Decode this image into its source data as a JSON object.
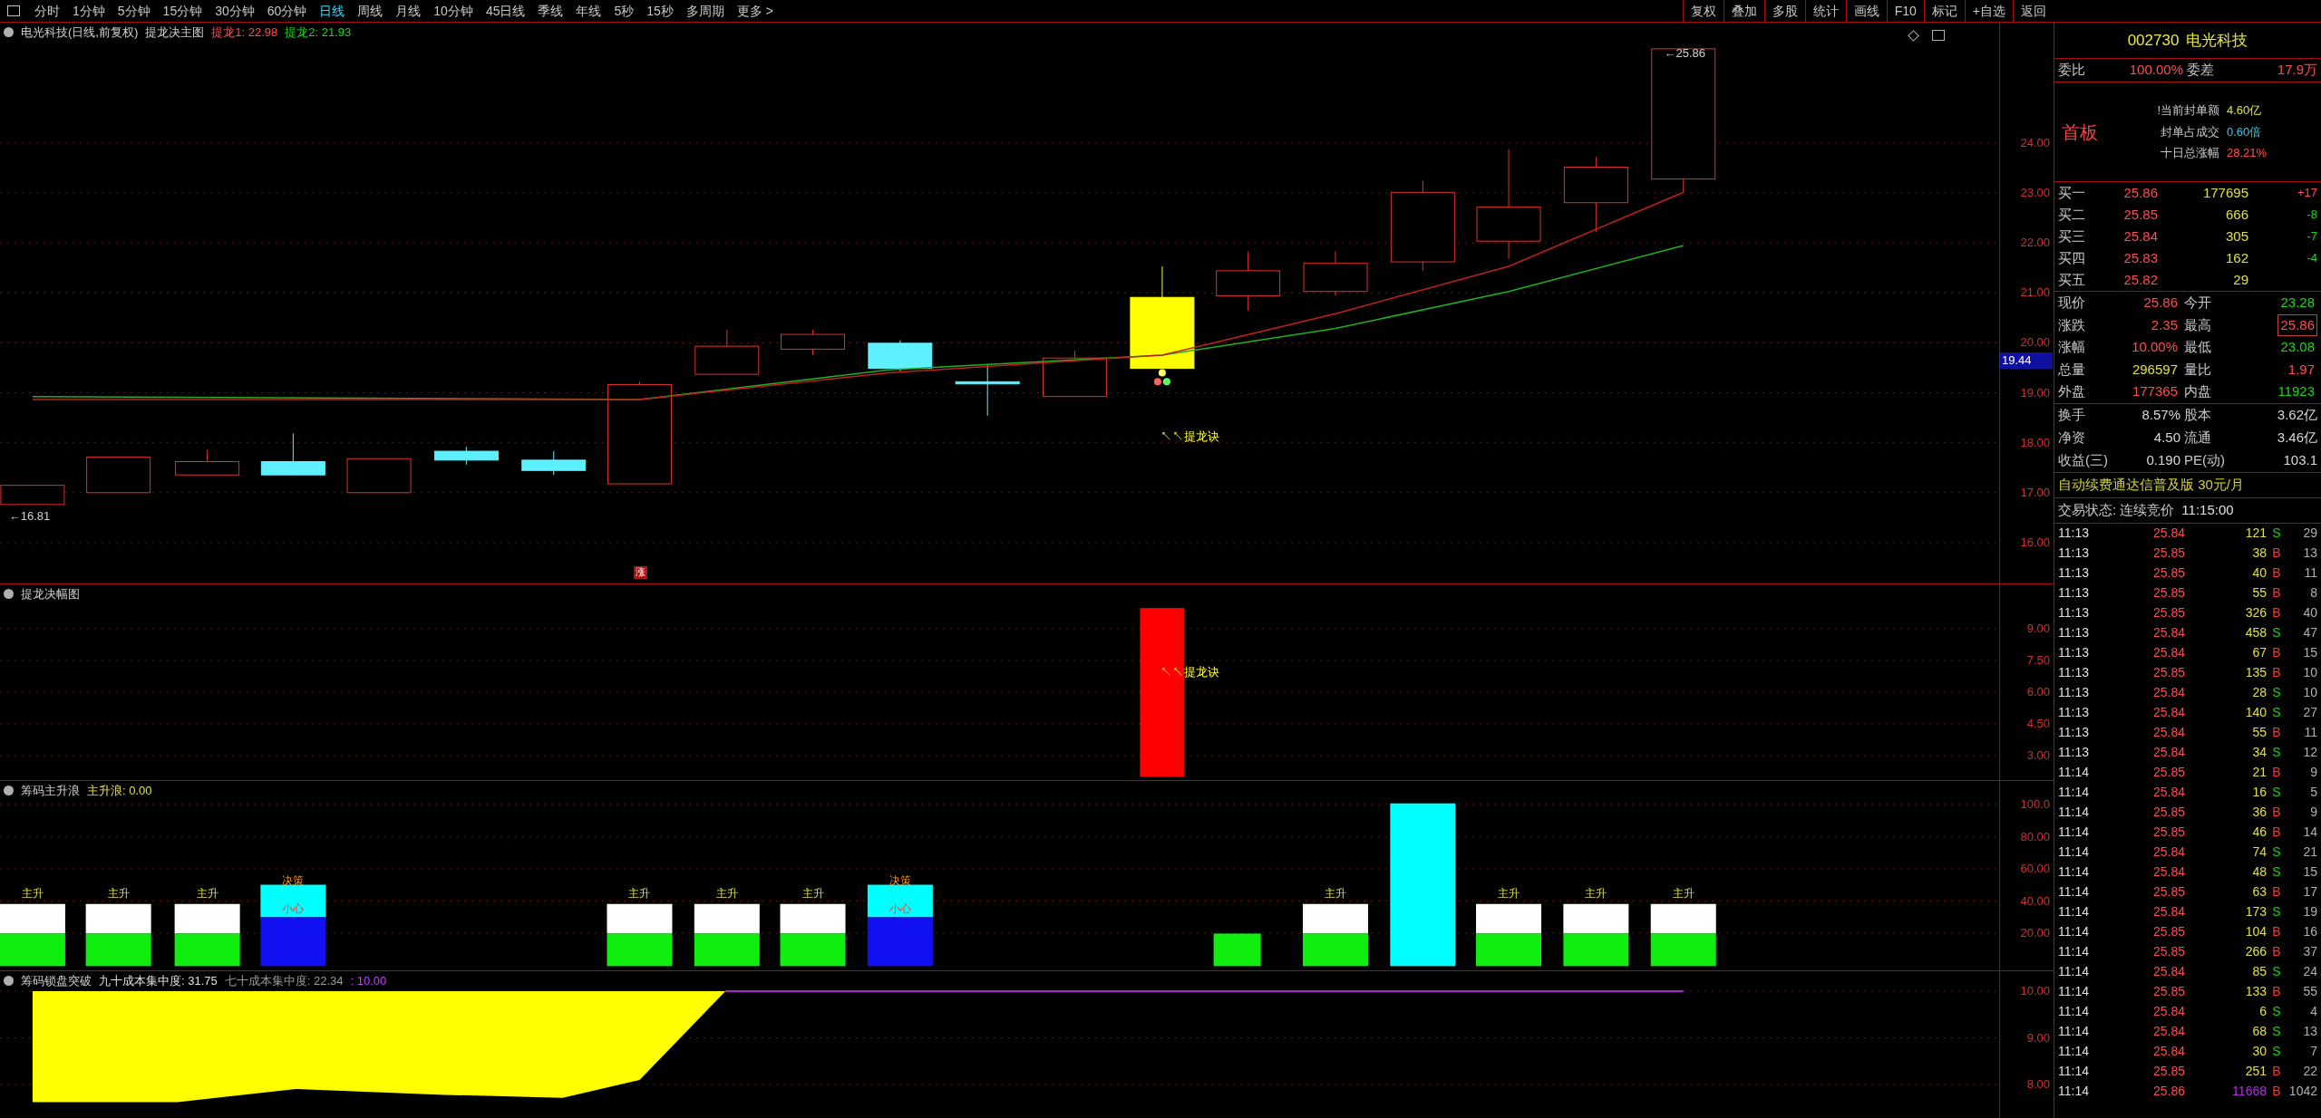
{
  "toolbar": {
    "periods": [
      {
        "label": "分时",
        "selected": false
      },
      {
        "label": "1分钟",
        "selected": false
      },
      {
        "label": "5分钟",
        "selected": false
      },
      {
        "label": "15分钟",
        "selected": false
      },
      {
        "label": "30分钟",
        "selected": false
      },
      {
        "label": "60分钟",
        "selected": false
      },
      {
        "label": "日线",
        "selected": true
      },
      {
        "label": "周线",
        "selected": false
      },
      {
        "label": "月线",
        "selected": false
      },
      {
        "label": "10分钟",
        "selected": false
      },
      {
        "label": "45日线",
        "selected": false
      },
      {
        "label": "季线",
        "selected": false
      },
      {
        "label": "年线",
        "selected": false
      },
      {
        "label": "5秒",
        "selected": false
      },
      {
        "label": "15秒",
        "selected": false
      },
      {
        "label": "多周期",
        "selected": false
      },
      {
        "label": "更多 >",
        "selected": false
      }
    ],
    "actions": [
      "复权",
      "叠加",
      "多股",
      "统计",
      "画线",
      "F10",
      "标记",
      "+自选",
      "返回"
    ]
  },
  "main_chart": {
    "title": "电光科技(日线,前复权)",
    "indicator": "提龙决主图",
    "legend": [
      {
        "text": "提龙1: 22.98",
        "color": "#ff4d4d"
      },
      {
        "text": "提龙2: 21.93",
        "color": "#18d818"
      }
    ],
    "annotations": [
      "←25.86",
      "←16.81",
      "↖↖提龙诀",
      "涨"
    ],
    "yticks": [
      "24.00",
      "23.00",
      "22.00",
      "21.00",
      "20.00",
      "19.00",
      "18.00",
      "17.00",
      "16.00"
    ],
    "current_price": "19.44"
  },
  "amplitude_chart": {
    "title": "提龙决幅图",
    "annotations": [
      "↖↖提龙诀"
    ],
    "yticks": [
      "9.00",
      "7.50",
      "6.00",
      "4.50",
      "3.00"
    ]
  },
  "wave_chart": {
    "title": "筹码主升浪",
    "legend": [
      {
        "text": "主升浪: 0.00",
        "color": "#e0e040"
      }
    ],
    "bar_labels": [
      {
        "text": "主升",
        "kind": "rise"
      },
      {
        "text": "主升",
        "kind": "rise"
      },
      {
        "text": "主升",
        "kind": "rise"
      },
      {
        "text": "决策",
        "kind": "decide"
      },
      {
        "text": "小心",
        "kind": "warn"
      },
      {
        "text": "主升",
        "kind": "rise"
      },
      {
        "text": "主升",
        "kind": "rise"
      },
      {
        "text": "主升",
        "kind": "rise"
      },
      {
        "text": "决策",
        "kind": "decide"
      },
      {
        "text": "小心",
        "kind": "warn"
      },
      {
        "text": "主升",
        "kind": "rise"
      },
      {
        "text": "主升",
        "kind": "rise"
      },
      {
        "text": "主升",
        "kind": "rise"
      },
      {
        "text": "主升",
        "kind": "rise"
      }
    ],
    "yticks": [
      "100.0",
      "80.00",
      "60.00",
      "40.00",
      "20.00"
    ]
  },
  "lock_chart": {
    "title": "筹码锁盘突破",
    "legend": [
      {
        "text": "九十成本集中度: 31.75",
        "color": "#e0e0e0"
      },
      {
        "text": "七十成本集中度: 22.34",
        "color": "#9a9a9a"
      },
      {
        "text": ": 10.00",
        "color": "#c040ff"
      }
    ],
    "yticks": [
      "10.00",
      "9.00",
      "8.00"
    ]
  },
  "quote_panel": {
    "code": "002730",
    "name": "电光科技",
    "ratio": {
      "label": "委比",
      "value": "100.00%",
      "diff_label": "委差",
      "diff_value": "17.9万"
    },
    "board": "首板",
    "seal_info": [
      {
        "label": "!当前封单额",
        "value": "4.60亿",
        "color": "#e0e040"
      },
      {
        "label": "封单占成交",
        "value": "0.60倍",
        "color": "#38c8e8"
      },
      {
        "label": "十日总涨幅",
        "value": "28.21%",
        "color": "#ff4d4d"
      }
    ],
    "bids": [
      {
        "label": "买一",
        "price": "25.86",
        "volume": "177695",
        "change": "+17",
        "color": "#ff4d4d"
      },
      {
        "label": "买二",
        "price": "25.85",
        "volume": "666",
        "change": "-8",
        "color": "#18d818"
      },
      {
        "label": "买三",
        "price": "25.84",
        "volume": "305",
        "change": "-7",
        "color": "#18d818"
      },
      {
        "label": "买四",
        "price": "25.83",
        "volume": "162",
        "change": "-4",
        "color": "#18d818"
      },
      {
        "label": "买五",
        "price": "25.82",
        "volume": "29"
      }
    ],
    "quotes": [
      {
        "cells": [
          {
            "label": "现价",
            "value": "25.86",
            "color": "#ff4d4d",
            "boxed": false
          },
          {
            "label": "今开",
            "value": "23.28",
            "color": "#18d818",
            "boxed": false
          }
        ]
      },
      {
        "cells": [
          {
            "label": "涨跌",
            "value": "2.35",
            "color": "#ff4d4d",
            "boxed": false
          },
          {
            "label": "最高",
            "value": "25.86",
            "color": "#ff4d4d",
            "boxed": true
          }
        ]
      },
      {
        "cells": [
          {
            "label": "涨幅",
            "value": "10.00%",
            "color": "#ff4d4d",
            "boxed": false
          },
          {
            "label": "最低",
            "value": "23.08",
            "color": "#18d818",
            "boxed": false
          }
        ]
      },
      {
        "cells": [
          {
            "label": "总量",
            "value": "296597",
            "color": "#e0e040",
            "boxed": false
          },
          {
            "label": "量比",
            "value": "1.97",
            "color": "#ff4d4d",
            "boxed": false
          }
        ]
      },
      {
        "cells": [
          {
            "label": "外盘",
            "value": "177365",
            "color": "#ff4d4d",
            "boxed": false
          },
          {
            "label": "内盘",
            "value": "11923",
            "color": "#18d818",
            "boxed": false
          }
        ]
      }
    ],
    "stats": [
      {
        "label": "换手",
        "value": "8.57%",
        "label2": "股本",
        "value2": "3.62亿"
      },
      {
        "label": "净资",
        "value": "4.50",
        "label2": "流通",
        "value2": "3.46亿"
      },
      {
        "label": "收益(三)",
        "value": "0.190",
        "label2": "PE(动)",
        "value2": "103.1"
      }
    ],
    "promo": "自动续费通达信普及版  30元/月",
    "status": {
      "label": "交易状态: 连续竞价",
      "time": "11:15:00"
    },
    "trades": [
      {
        "time": "11:13",
        "price": "25.84",
        "volume": "121",
        "side": "S",
        "kind": "sell",
        "count": "29",
        "large": false
      },
      {
        "time": "11:13",
        "price": "25.85",
        "volume": "38",
        "side": "B",
        "kind": "buy",
        "count": "13",
        "large": false
      },
      {
        "time": "11:13",
        "price": "25.85",
        "volume": "40",
        "side": "B",
        "kind": "buy",
        "count": "11",
        "large": false
      },
      {
        "time": "11:13",
        "price": "25.85",
        "volume": "55",
        "side": "B",
        "kind": "buy",
        "count": "8",
        "large": false
      },
      {
        "time": "11:13",
        "price": "25.85",
        "volume": "326",
        "side": "B",
        "kind": "buy",
        "count": "40",
        "large": false
      },
      {
        "time": "11:13",
        "price": "25.84",
        "volume": "458",
        "side": "S",
        "kind": "sell",
        "count": "47",
        "large": false
      },
      {
        "time": "11:13",
        "price": "25.84",
        "volume": "67",
        "side": "B",
        "kind": "buy",
        "count": "15",
        "large": false
      },
      {
        "time": "11:13",
        "price": "25.85",
        "volume": "135",
        "side": "B",
        "kind": "buy",
        "count": "10",
        "large": false
      },
      {
        "time": "11:13",
        "price": "25.84",
        "volume": "28",
        "side": "S",
        "kind": "sell",
        "count": "10",
        "large": false
      },
      {
        "time": "11:13",
        "price": "25.84",
        "volume": "140",
        "side": "S",
        "kind": "sell",
        "count": "27",
        "large": false
      },
      {
        "time": "11:13",
        "price": "25.84",
        "volume": "55",
        "side": "B",
        "kind": "buy",
        "count": "11",
        "large": false
      },
      {
        "time": "11:13",
        "price": "25.84",
        "volume": "34",
        "side": "S",
        "kind": "sell",
        "count": "12",
        "large": false
      },
      {
        "time": "11:14",
        "price": "25.85",
        "volume": "21",
        "side": "B",
        "kind": "buy",
        "count": "9",
        "large": false
      },
      {
        "time": "11:14",
        "price": "25.84",
        "volume": "16",
        "side": "S",
        "kind": "sell",
        "count": "5",
        "large": false
      },
      {
        "time": "11:14",
        "price": "25.85",
        "volume": "36",
        "side": "B",
        "kind": "buy",
        "count": "9",
        "large": false
      },
      {
        "time": "11:14",
        "price": "25.85",
        "volume": "46",
        "side": "B",
        "kind": "buy",
        "count": "14",
        "large": false
      },
      {
        "time": "11:14",
        "price": "25.84",
        "volume": "74",
        "side": "S",
        "kind": "sell",
        "count": "21",
        "large": false
      },
      {
        "time": "11:14",
        "price": "25.84",
        "volume": "48",
        "side": "S",
        "kind": "sell",
        "count": "15",
        "large": false
      },
      {
        "time": "11:14",
        "price": "25.85",
        "volume": "63",
        "side": "B",
        "kind": "buy",
        "count": "17",
        "large": false
      },
      {
        "time": "11:14",
        "price": "25.84",
        "volume": "173",
        "side": "S",
        "kind": "sell",
        "count": "19",
        "large": false
      },
      {
        "time": "11:14",
        "price": "25.85",
        "volume": "104",
        "side": "B",
        "kind": "buy",
        "count": "16",
        "large": false
      },
      {
        "time": "11:14",
        "price": "25.85",
        "volume": "266",
        "side": "B",
        "kind": "buy",
        "count": "37",
        "large": false
      },
      {
        "time": "11:14",
        "price": "25.84",
        "volume": "85",
        "side": "S",
        "kind": "sell",
        "count": "24",
        "large": false
      },
      {
        "time": "11:14",
        "price": "25.85",
        "volume": "133",
        "side": "B",
        "kind": "buy",
        "count": "55",
        "large": false
      },
      {
        "time": "11:14",
        "price": "25.84",
        "volume": "6",
        "side": "S",
        "kind": "sell",
        "count": "4",
        "large": false
      },
      {
        "time": "11:14",
        "price": "25.84",
        "volume": "68",
        "side": "S",
        "kind": "sell",
        "count": "13",
        "large": false
      },
      {
        "time": "11:14",
        "price": "25.84",
        "volume": "30",
        "side": "S",
        "kind": "sell",
        "count": "7",
        "large": false
      },
      {
        "time": "11:14",
        "price": "25.85",
        "volume": "251",
        "side": "B",
        "kind": "buy",
        "count": "22",
        "large": false
      },
      {
        "time": "11:14",
        "price": "25.86",
        "volume": "11668",
        "side": "B",
        "kind": "buy",
        "count": "1042",
        "large": true
      }
    ]
  }
}
